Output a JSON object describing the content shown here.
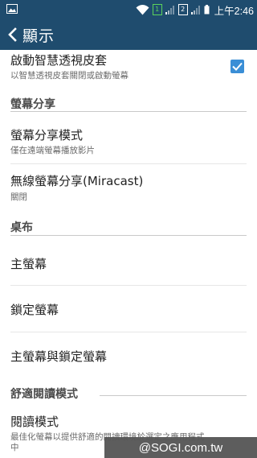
{
  "statusbar": {
    "sim1": "1",
    "sim2": "2",
    "time": "上午2:46"
  },
  "appbar": {
    "title": "顯示"
  },
  "settings": {
    "smart_cover": {
      "title": "啟動智慧透視皮套",
      "subtitle": "以智慧透視皮套關閉或啟動螢幕",
      "checked": true
    },
    "section_screen_share": "螢幕分享",
    "screen_share_mode": {
      "title": "螢幕分享模式",
      "subtitle": "僅在遠端螢幕播放影片"
    },
    "miracast": {
      "title": "無線螢幕分享(Miracast)",
      "subtitle": "關閉"
    },
    "section_wallpaper": "桌布",
    "home_screen": {
      "title": "主螢幕"
    },
    "lock_screen": {
      "title": "鎖定螢幕"
    },
    "home_and_lock": {
      "title": "主螢幕與鎖定螢幕"
    },
    "section_reading": "舒適閱讀模式",
    "reading_mode": {
      "title": "閱讀模式",
      "subtitle_line1": "最佳化螢幕以提供舒適的閱讀環境於選定之應用程式",
      "subtitle_line2": "中"
    }
  },
  "watermark": "@SOGI.com.tw",
  "colors": {
    "bar": "#1f4c6e",
    "accent": "#3a8ed6"
  }
}
